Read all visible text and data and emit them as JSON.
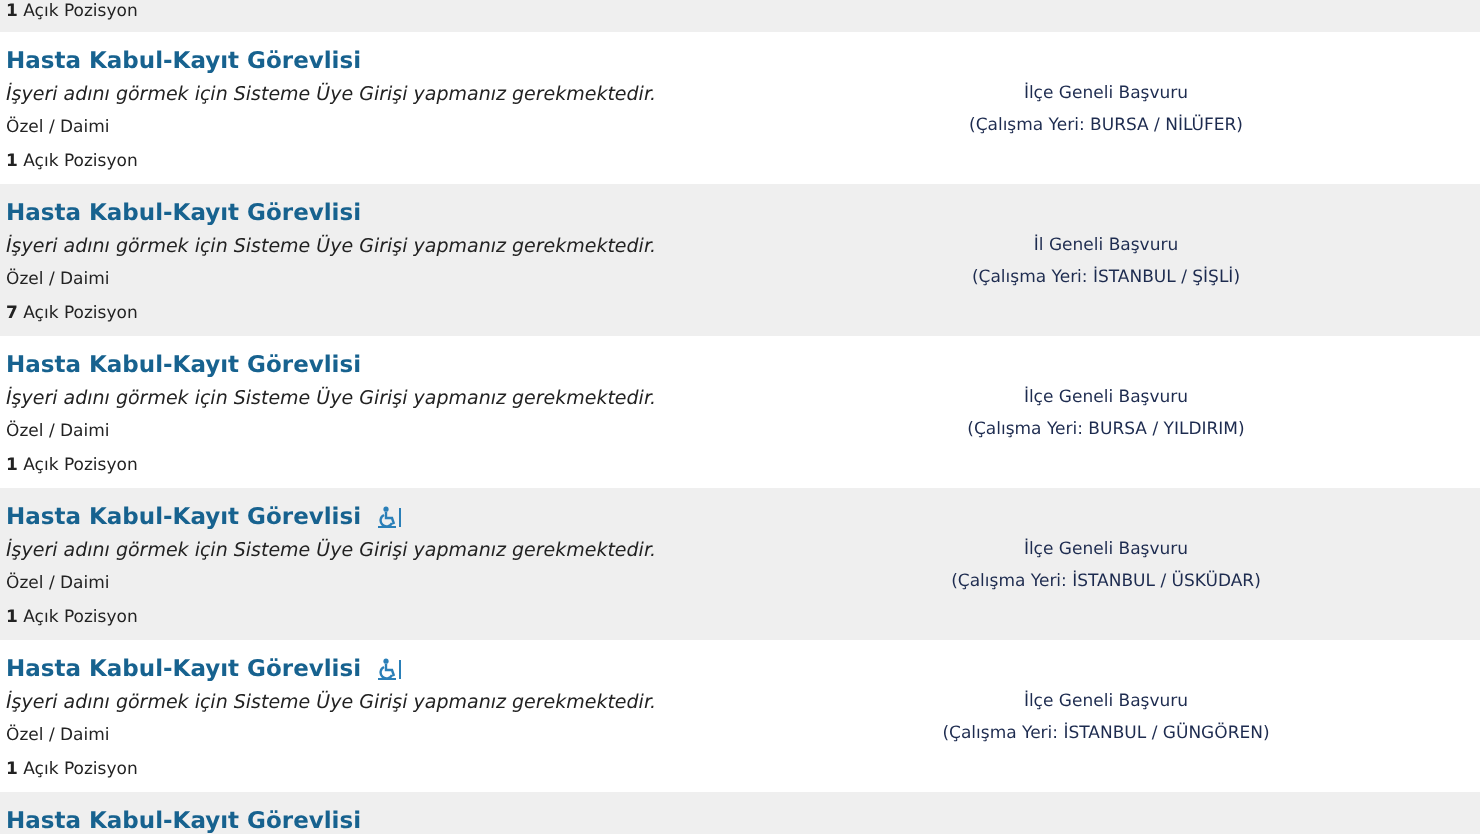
{
  "listings": [
    {
      "positions": "**1** Açık Pozisyon"
    },
    {
      "title": "Hasta Kabul-Kayıt Görevlisi",
      "accessible": false,
      "employer_note": "İşyeri adını görmek için Sisteme Üye Girişi yapmanız gerekmektedir.",
      "type": "Özel / Daimi",
      "positions": "**1** Açık Pozisyon",
      "scope": "İlçe Geneli Başvuru",
      "location": "(Çalışma Yeri: BURSA / NİLÜFER)"
    },
    {
      "title": "Hasta Kabul-Kayıt Görevlisi",
      "accessible": false,
      "employer_note": "İşyeri adını görmek için Sisteme Üye Girişi yapmanız gerekmektedir.",
      "type": "Özel / Daimi",
      "positions": "**7** Açık Pozisyon",
      "scope": "İl Geneli Başvuru",
      "location": "(Çalışma Yeri: İSTANBUL / ŞİŞLİ)"
    },
    {
      "title": "Hasta Kabul-Kayıt Görevlisi",
      "accessible": false,
      "employer_note": "İşyeri adını görmek için Sisteme Üye Girişi yapmanız gerekmektedir.",
      "type": "Özel / Daimi",
      "positions": "**1** Açık Pozisyon",
      "scope": "İlçe Geneli Başvuru",
      "location": "(Çalışma Yeri: BURSA / YILDIRIM)"
    },
    {
      "title": "Hasta Kabul-Kayıt Görevlisi",
      "accessible": true,
      "employer_note": "İşyeri adını görmek için Sisteme Üye Girişi yapmanız gerekmektedir.",
      "type": "Özel / Daimi",
      "positions": "**1** Açık Pozisyon",
      "scope": "İlçe Geneli Başvuru",
      "location": "(Çalışma Yeri: İSTANBUL / ÜSKÜDAR)"
    },
    {
      "title": "Hasta Kabul-Kayıt Görevlisi",
      "accessible": true,
      "employer_note": "İşyeri adını görmek için Sisteme Üye Girişi yapmanız gerekmektedir.",
      "type": "Özel / Daimi",
      "positions": "**1** Açık Pozisyon",
      "scope": "İlçe Geneli Başvuru",
      "location": "(Çalışma Yeri: İSTANBUL / GÜNGÖREN)"
    },
    {
      "title": "Hasta Kabul-Kayıt Görevlisi",
      "accessible": false
    }
  ]
}
